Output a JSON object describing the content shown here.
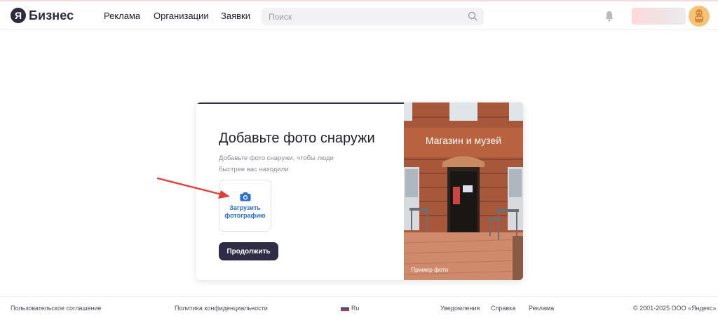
{
  "header": {
    "logo_letter": "Я",
    "logo_text": "Бизнес",
    "nav": [
      "Реклама",
      "Организации",
      "Заявки"
    ],
    "search_placeholder": "Поиск",
    "icons": [
      "search-icon",
      "bell-icon",
      "avatar-icon"
    ]
  },
  "card": {
    "title": "Добавьте фото снаружи",
    "subtitle": "Добавьте фото снаружи, чтобы люди быстрее вас находили",
    "upload_label": "Загрузить фотографию",
    "continue_label": "Продолжить",
    "photo_sign": "Магазин и музей",
    "photo_caption": "Пример фото",
    "accent_color": "#2e2d45",
    "link_color": "#2a6fcf"
  },
  "footer": {
    "user_agreement": "Пользовательское соглашение",
    "privacy": "Политика конфиденциальности",
    "language": "Ru",
    "notifications": "Уведомления",
    "help": "Справка",
    "ads": "Реклама",
    "copyright": "© 2001-2025 ООО «Яндекс»"
  }
}
